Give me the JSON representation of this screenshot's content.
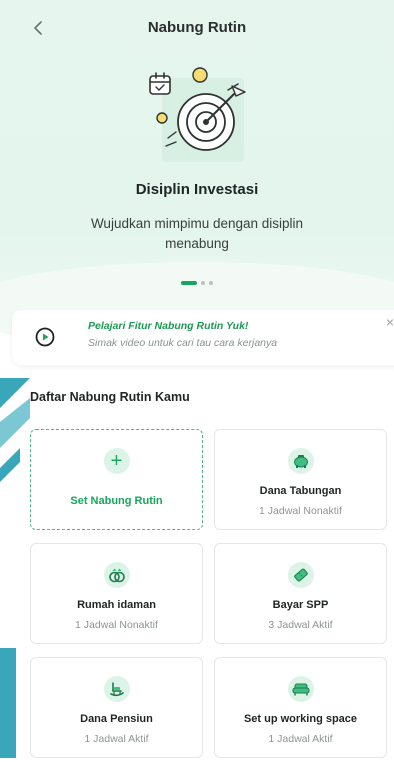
{
  "header": {
    "title": "Nabung Rutin"
  },
  "hero": {
    "slide_title": "Disiplin Investasi",
    "slide_desc": "Wujudkan mimpimu dengan disiplin menabung",
    "slides_count": 3,
    "active_slide": 1
  },
  "promo": {
    "title": "Pelajari Fitur Nabung Rutin Yuk!",
    "subtitle": "Simak video untuk cari tau cara kerjanya",
    "close": "×"
  },
  "list": {
    "heading": "Daftar Nabung Rutin Kamu",
    "add_label": "Set Nabung Rutin",
    "items": [
      {
        "name": "Dana Tabungan",
        "status": "1 Jadwal Nonaktif",
        "icon": "piggy-bank-icon"
      },
      {
        "name": "Rumah idaman",
        "status": "1 Jadwal Nonaktif",
        "icon": "rings-icon"
      },
      {
        "name": "Bayar SPP",
        "status": "3 Jadwal Aktif",
        "icon": "ticket-icon"
      },
      {
        "name": "Dana Pensiun",
        "status": "1 Jadwal Aktif",
        "icon": "rocking-chair-icon"
      },
      {
        "name": "Set up working space",
        "status": "1 Jadwal Aktif",
        "icon": "sofa-icon"
      }
    ]
  },
  "colors": {
    "accent": "#17a55d",
    "hero_bg": "#e6f6ef",
    "icon_bg": "#dcf3e7",
    "deco": "#3aa6b9"
  }
}
